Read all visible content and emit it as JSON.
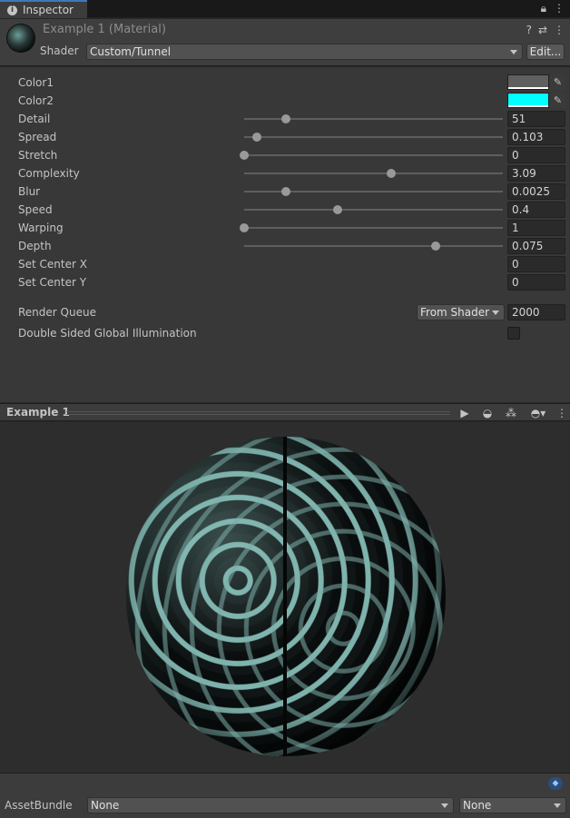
{
  "tab": {
    "title": "Inspector"
  },
  "header": {
    "title": "Example 1 (Material)",
    "shader_label": "Shader",
    "shader_value": "Custom/Tunnel",
    "edit_label": "Edit..."
  },
  "colors": {
    "color1": "#5f5f5f",
    "color2": "#00ffff"
  },
  "properties": {
    "color1_label": "Color1",
    "color2_label": "Color2",
    "sliders": [
      {
        "label": "Detail",
        "value": "51",
        "fraction": 0.16
      },
      {
        "label": "Spread",
        "value": "0.103",
        "fraction": 0.05
      },
      {
        "label": "Stretch",
        "value": "0",
        "fraction": 0.0
      },
      {
        "label": "Complexity",
        "value": "3.09",
        "fraction": 0.57
      },
      {
        "label": "Blur",
        "value": "0.0025",
        "fraction": 0.16
      },
      {
        "label": "Speed",
        "value": "0.4",
        "fraction": 0.36
      },
      {
        "label": "Warping",
        "value": "1",
        "fraction": 0.0
      },
      {
        "label": "Depth",
        "value": "0.075",
        "fraction": 0.74
      }
    ],
    "set_center_x_label": "Set Center X",
    "set_center_x_value": "0",
    "set_center_y_label": "Set Center Y",
    "set_center_y_value": "0",
    "render_queue_label": "Render Queue",
    "render_queue_mode": "From Shader",
    "render_queue_value": "2000",
    "double_sided_gi_label": "Double Sided Global Illumination"
  },
  "preview": {
    "title": "Example 1"
  },
  "footer": {
    "asset_bundle_label": "AssetBundle",
    "asset_bundle_value": "None",
    "variant_value": "None"
  }
}
